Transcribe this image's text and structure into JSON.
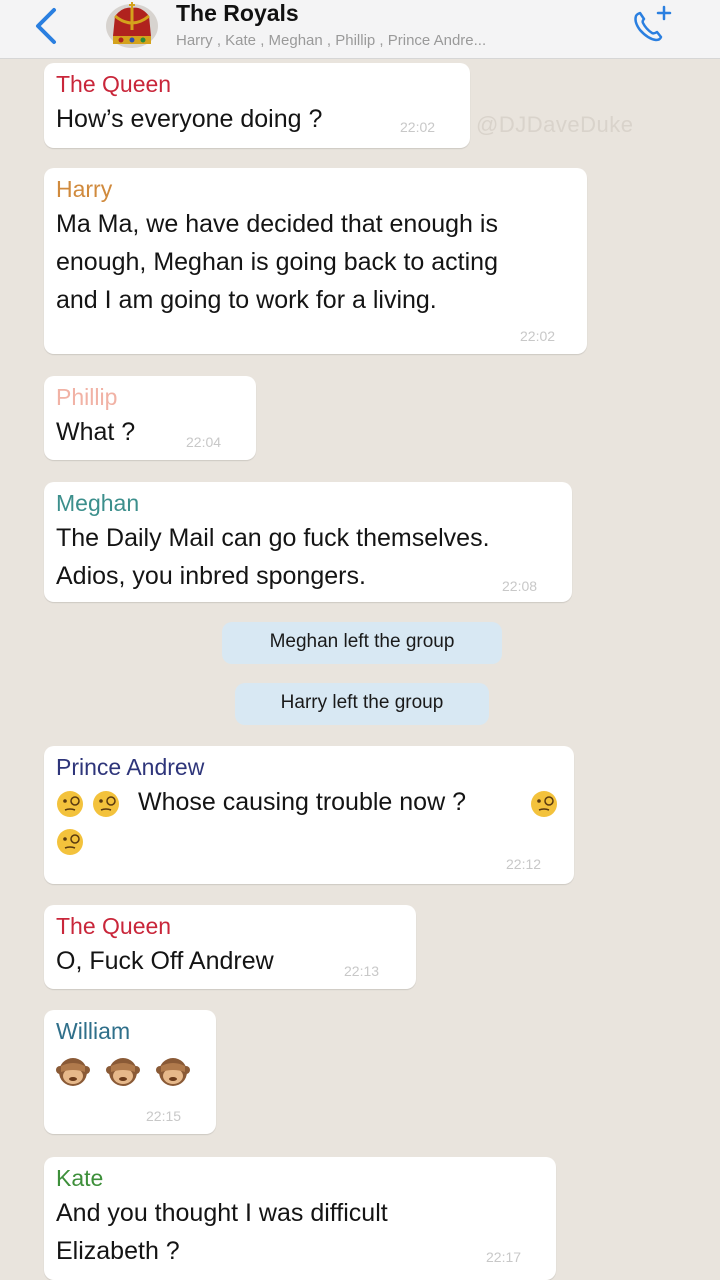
{
  "header": {
    "title": "The Royals",
    "members": "Harry , Kate , Meghan , Phillip , Prince Andre..."
  },
  "watermark": "@DJDaveDuke",
  "messages": [
    {
      "sender": "The Queen",
      "sender_color": "#c9263a",
      "text": [
        "How’s everyone doing ?"
      ],
      "time": "22:02"
    },
    {
      "sender": "Harry",
      "sender_color": "#d08a3d",
      "text": [
        "Ma Ma, we have decided that enough is",
        "enough, Meghan is going back to acting",
        "and I am going to work for a living."
      ],
      "time": "22:02"
    },
    {
      "sender": "Phillip",
      "sender_color": "#f1b2a5",
      "text": [
        "What ?"
      ],
      "time": "22:04"
    },
    {
      "sender": "Meghan",
      "sender_color": "#3c8f8c",
      "text": [
        "The Daily Mail can go fuck themselves.",
        "Adios, you inbred spongers."
      ],
      "time": "22:08"
    },
    {
      "sender": "Prince Andrew",
      "sender_color": "#2e357a",
      "text": [
        "Whose causing trouble now ?"
      ],
      "emoji": "face-with-monocle",
      "time": "22:12"
    },
    {
      "sender": "The Queen",
      "sender_color": "#c9263a",
      "text": [
        "O, Fuck Off Andrew"
      ],
      "time": "22:13"
    },
    {
      "sender": "William",
      "sender_color": "#2f6f8a",
      "text": [],
      "emoji": "see-no-evil-monkey",
      "time": "22:15"
    },
    {
      "sender": "Kate",
      "sender_color": "#3d8f3a",
      "text": [
        "And you thought I was difficult",
        "Elizabeth ?"
      ],
      "time": "22:17"
    }
  ],
  "system_messages": [
    "Meghan left the group",
    "Harry left the group"
  ]
}
